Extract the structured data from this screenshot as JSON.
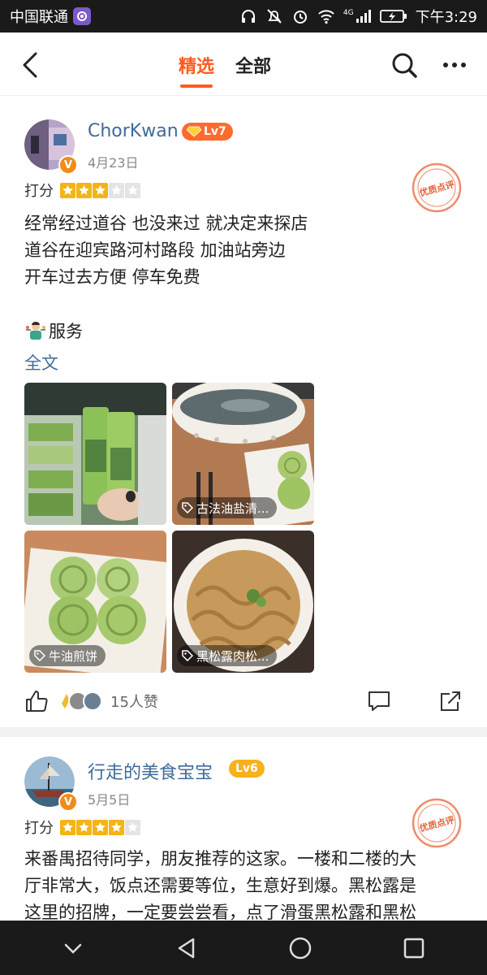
{
  "status_bar": {
    "carrier": "中国联通",
    "network": "4G",
    "time": "下午3:29"
  },
  "nav": {
    "tabs": [
      {
        "label": "精选",
        "active": true
      },
      {
        "label": "全部",
        "active": false
      }
    ]
  },
  "reviews": [
    {
      "user": "ChorKwan",
      "level": "Lv7",
      "date": "4月23日",
      "rating_label": "打分",
      "rating": 3,
      "stamp_text": "优质点评",
      "text_lines": [
        "经常经过道谷 也没来过 就决定来探店",
        "道谷在迎宾路河村路段 加油站旁边",
        "开车过去方便 停车免费"
      ],
      "service_label": "服务",
      "fulltext_label": "全文",
      "photos": [
        {
          "tag": ""
        },
        {
          "tag": "古法油盐清..."
        },
        {
          "tag": "牛油煎饼"
        },
        {
          "tag": "黑松露肉松..."
        }
      ],
      "likes_text": "15人赞"
    },
    {
      "user": "行走的美食宝宝",
      "level": "Lv6",
      "date": "5月5日",
      "rating_label": "打分",
      "rating": 4,
      "stamp_text": "优质点评",
      "text_lines": [
        "来番禺招待同学，朋友推荐的这家。一楼和二楼的大",
        "厅非常大，饭点还需要等位，生意好到爆。黑松露是",
        "这里的招牌，一定要尝尝看，点了滑蛋黑松露和黑松"
      ]
    }
  ],
  "colors": {
    "accent": "#ff5a1f",
    "link": "#3e6b9a",
    "star": "#f4b417"
  }
}
